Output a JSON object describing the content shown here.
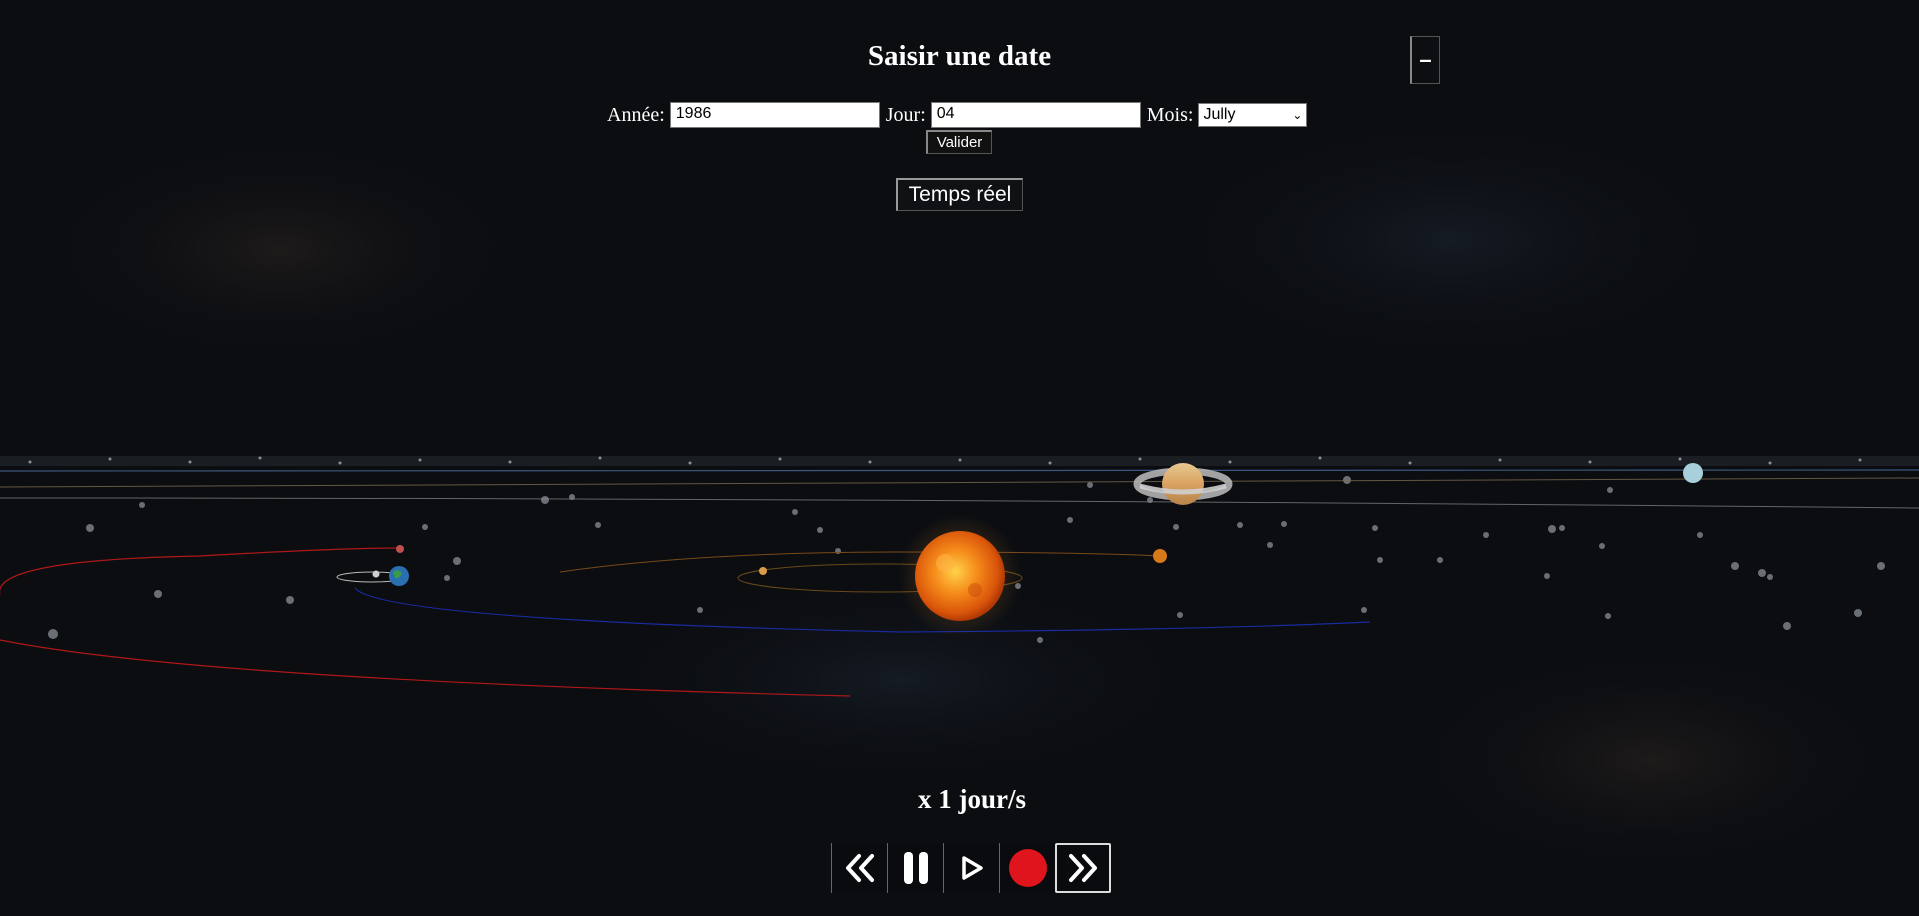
{
  "date_panel": {
    "title": "Saisir une date",
    "collapse_label": "–",
    "year_label": "Année:",
    "year_value": "1986",
    "day_label": "Jour:",
    "day_value": "04",
    "month_label": "Mois:",
    "month_value": "Jully",
    "validate_label": "Valider",
    "realtime_label": "Temps réel"
  },
  "playback": {
    "speed_text": "x 1 jour/s",
    "buttons": [
      {
        "name": "rewind-button",
        "icon": "double-chevron-left-icon"
      },
      {
        "name": "pause-button",
        "icon": "pause-icon"
      },
      {
        "name": "play-button",
        "icon": "play-icon"
      },
      {
        "name": "record-button",
        "icon": "record-dot-icon"
      },
      {
        "name": "fast-forward-button",
        "icon": "double-chevron-right-icon"
      }
    ],
    "record_color": "#e0141c"
  },
  "scene": {
    "background": "#0b0d11",
    "bodies": [
      "sun",
      "mercury",
      "venus",
      "earth",
      "moon",
      "mars",
      "jupiter",
      "saturn",
      "uranus"
    ],
    "colors": {
      "sun": "#f07a12",
      "earth_orbit": "#1a2aa0",
      "mars_orbit": "#b01818",
      "inner_orbit": "#7a4a1a",
      "outer_orbit": "#8a8a8a"
    }
  }
}
